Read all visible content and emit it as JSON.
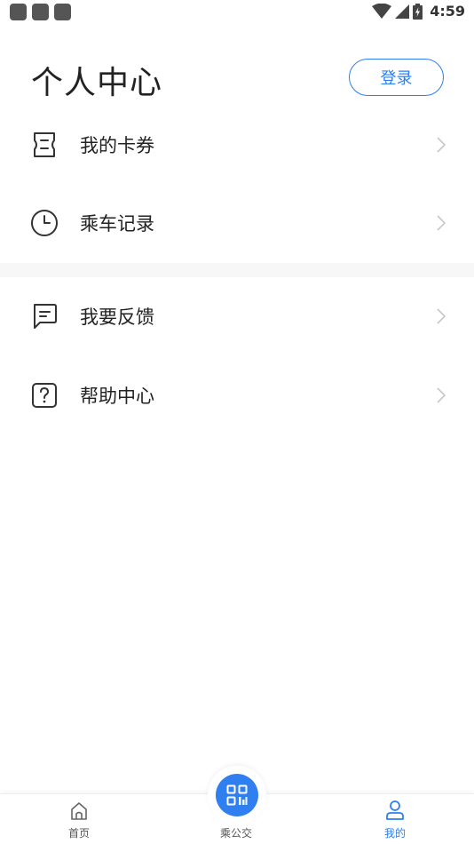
{
  "status_bar": {
    "time": "4:59",
    "icons": [
      "notification-square-icon",
      "notification-square-icon",
      "notification-square-icon",
      "wifi-icon",
      "cell-signal-icon",
      "battery-charging-icon"
    ]
  },
  "header": {
    "title": "个人中心",
    "login_label": "登录"
  },
  "menu": {
    "items": [
      {
        "label": "我的卡券",
        "icon": "ticket-icon"
      },
      {
        "label": "乘车记录",
        "icon": "clock-icon"
      },
      {
        "label": "我要反馈",
        "icon": "feedback-icon"
      },
      {
        "label": "帮助中心",
        "icon": "help-icon"
      }
    ]
  },
  "bottom_nav": {
    "items": [
      {
        "label": "首页",
        "icon": "home-icon",
        "active": false
      },
      {
        "label": "乘公交",
        "icon": "qr-code-icon",
        "active": false
      },
      {
        "label": "我的",
        "icon": "user-icon",
        "active": true
      }
    ]
  },
  "colors": {
    "accent": "#2f7ff0",
    "text": "#222222",
    "muted": "#555555",
    "band": "#f7f7f7"
  }
}
